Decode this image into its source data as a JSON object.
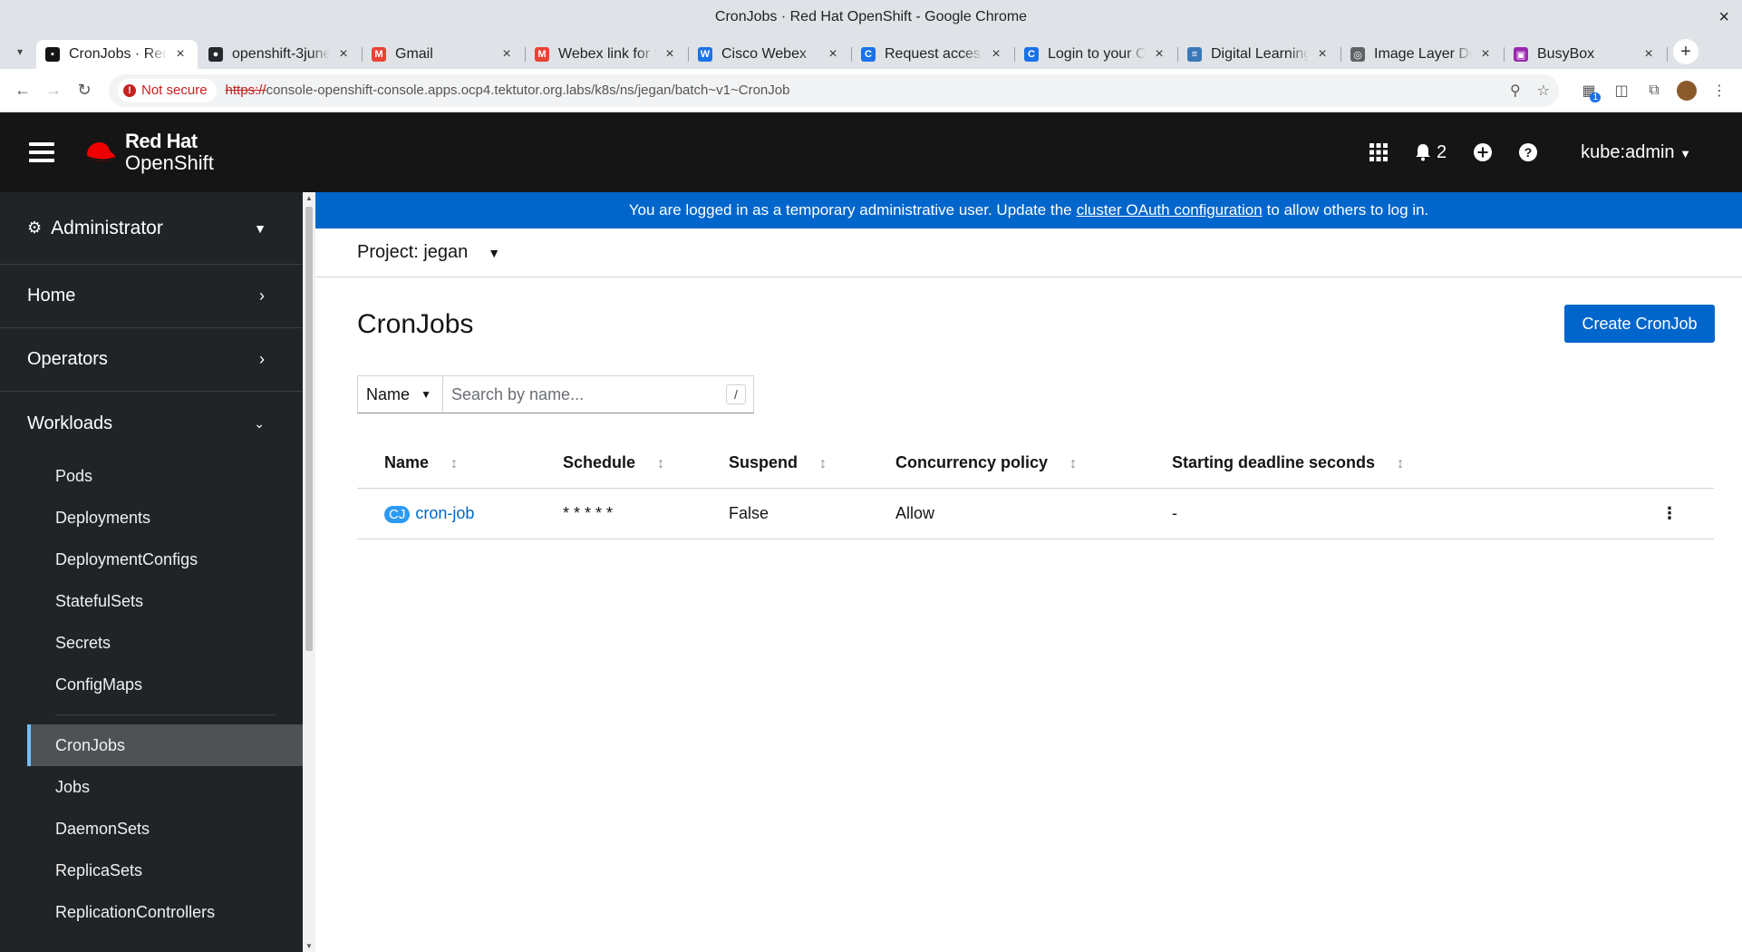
{
  "window": {
    "title": "CronJobs · Red Hat OpenShift - Google Chrome",
    "close": "×"
  },
  "tabs": [
    {
      "title": "CronJobs · Red Hat",
      "color": "#151515",
      "glyph": "▪",
      "active": true
    },
    {
      "title": "openshift-3june",
      "color": "#24292e",
      "glyph": "●"
    },
    {
      "title": "Gmail",
      "color": "#ea4335",
      "glyph": "M"
    },
    {
      "title": "Webex link for th",
      "color": "#ea4335",
      "glyph": "M"
    },
    {
      "title": "Cisco Webex",
      "color": "#1a73e8",
      "glyph": "W"
    },
    {
      "title": "Request access",
      "color": "#1a73e8",
      "glyph": "C"
    },
    {
      "title": "Login to your Ca",
      "color": "#1a73e8",
      "glyph": "C"
    },
    {
      "title": "Digital Learning",
      "color": "#3b78b7",
      "glyph": "≡"
    },
    {
      "title": "Image Layer Det",
      "color": "#5f6368",
      "glyph": "◎"
    },
    {
      "title": "BusyBox",
      "color": "#9c27b0",
      "glyph": "▣"
    }
  ],
  "toolbar": {
    "not_secure": "Not secure",
    "url_proto": "https://",
    "url_rest": "console-openshift-console.apps.ocp4.tektutor.org.labs/k8s/ns/jegan/batch~v1~CronJob",
    "extension_badge": "1"
  },
  "masthead": {
    "brand_top": "Red Hat",
    "brand_bottom": "OpenShift",
    "notification_count": "2",
    "user": "kube:admin"
  },
  "sidebar": {
    "perspective": "Administrator",
    "sections": [
      {
        "label": "Home"
      },
      {
        "label": "Operators"
      },
      {
        "label": "Workloads"
      }
    ],
    "workloads_items_a": [
      "Pods",
      "Deployments",
      "DeploymentConfigs",
      "StatefulSets",
      "Secrets",
      "ConfigMaps"
    ],
    "workloads_items_b": [
      "CronJobs",
      "Jobs",
      "DaemonSets",
      "ReplicaSets",
      "ReplicationControllers"
    ]
  },
  "banner": {
    "before": "You are logged in as a temporary administrative user. Update the",
    "link": "cluster OAuth configuration",
    "after": "to allow others to log in."
  },
  "project": {
    "label": "Project: jegan"
  },
  "page": {
    "title": "CronJobs",
    "create_button": "Create CronJob"
  },
  "filter": {
    "select": "Name",
    "placeholder": "Search by name...",
    "shortcut": "/"
  },
  "table": {
    "columns": [
      "Name",
      "Schedule",
      "Suspend",
      "Concurrency policy",
      "Starting deadline seconds"
    ],
    "rows": [
      {
        "badge": "CJ",
        "name": "cron-job",
        "schedule": "* * * * *",
        "suspend": "False",
        "concurrency": "Allow",
        "deadline": "-"
      }
    ]
  }
}
